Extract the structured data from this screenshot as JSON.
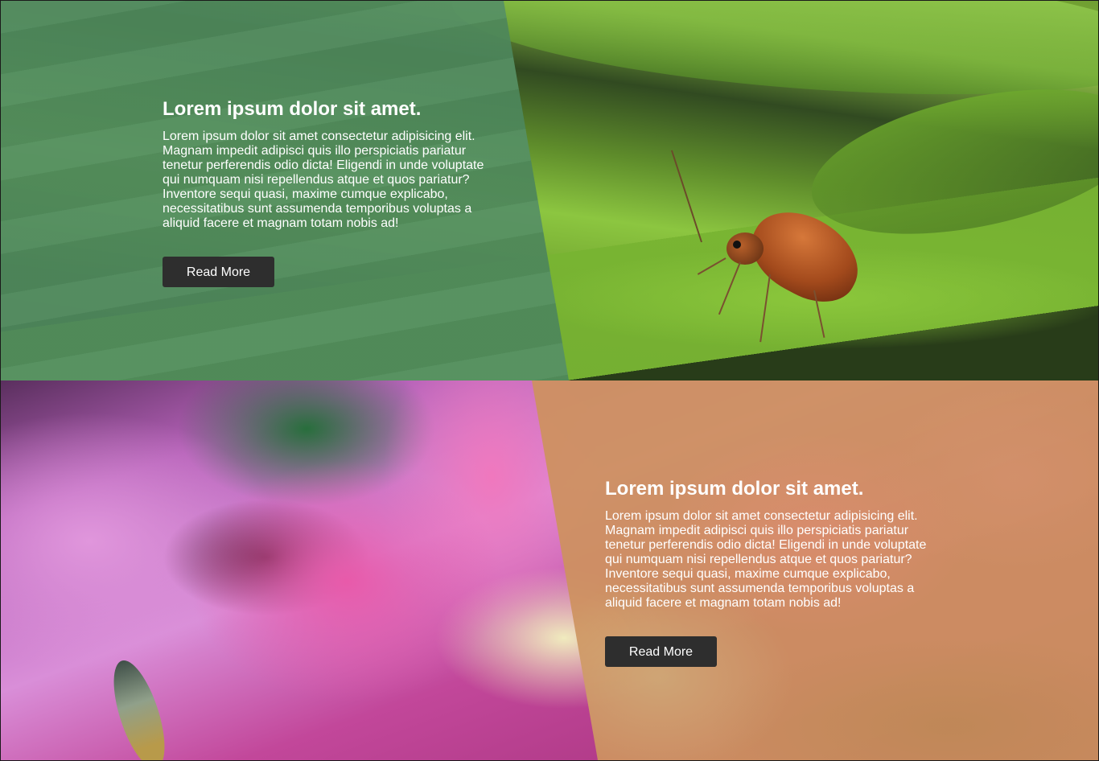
{
  "cards": [
    {
      "title": "Lorem ipsum dolor sit amet.",
      "body": "Lorem ipsum dolor sit amet consectetur adipisicing elit. Magnam impedit adipisci quis illo perspiciatis pariatur tenetur perferendis odio dicta! Eligendi in unde voluptate qui numquam nisi repellendus atque et quos pariatur? Inventore sequi quasi, maxime cumque explicabo, necessitatibus sunt assumenda temporibus voluptas a aliquid facere et magnam totam nobis ad!",
      "button_label": "Read More",
      "overlay_color": "#508c5f",
      "image": "leaf-beetle-photo"
    },
    {
      "title": "Lorem ipsum dolor sit amet.",
      "body": "Lorem ipsum dolor sit amet consectetur adipisicing elit. Magnam impedit adipisci quis illo perspiciatis pariatur tenetur perferendis odio dicta! Eligendi in unde voluptate qui numquam nisi repellendus atque et quos pariatur? Inventore sequi quasi, maxime cumque explicabo, necessitatibus sunt assumenda temporibus voluptas a aliquid facere et magnam totam nobis ad!",
      "button_label": "Read More",
      "overlay_color": "#cd915f",
      "image": "pink-flower-photo"
    }
  ],
  "colors": {
    "button_bg": "#2e2e2e",
    "text": "#ffffff"
  }
}
